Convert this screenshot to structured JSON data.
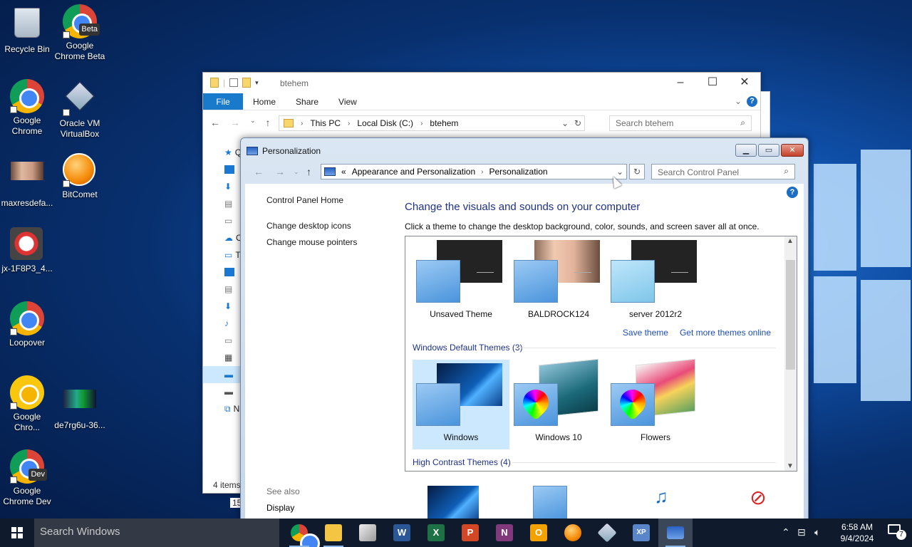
{
  "desktop": {
    "icons": [
      {
        "label": "Recycle Bin",
        "icon": "recycle-bin-icon"
      },
      {
        "label": "Google Chrome Beta",
        "icon": "chrome-beta-icon",
        "badge": "Beta"
      },
      {
        "label": "Google Chrome",
        "icon": "chrome-icon"
      },
      {
        "label": "Oracle VM VirtualBox",
        "icon": "virtualbox-icon"
      },
      {
        "label": "maxresdefa...",
        "icon": "image-file-icon"
      },
      {
        "label": "BitComet",
        "icon": "bitcomet-icon"
      },
      {
        "label": "jx-1F8P3_4...",
        "icon": "app-icon"
      },
      {
        "label": "Loopover",
        "icon": "chrome-app-icon"
      },
      {
        "label": "Google Chro...",
        "icon": "chrome-canary-icon"
      },
      {
        "label": "de7rg6u-36...",
        "icon": "image-file-icon"
      },
      {
        "label": "Google Chrome Dev",
        "icon": "chrome-dev-icon",
        "badge": "Dev"
      }
    ]
  },
  "explorer": {
    "title": "btehem",
    "ribbon_tabs": [
      "File",
      "Home",
      "Share",
      "View"
    ],
    "address": [
      "This PC",
      "Local Disk (C:)",
      "btehem"
    ],
    "search_placeholder": "Search btehem",
    "status": "4 items",
    "status2": "15",
    "nav_cut_letters": [
      "Q",
      "O",
      "T",
      "N"
    ]
  },
  "personalization": {
    "title": "Personalization",
    "breadcrumb_prefix": "«",
    "address": [
      "Appearance and Personalization",
      "Personalization"
    ],
    "search_placeholder": "Search Control Panel",
    "left_links": {
      "home": "Control Panel Home",
      "items": [
        "Change desktop icons",
        "Change mouse pointers"
      ]
    },
    "see_also": {
      "heading": "See also",
      "items": [
        "Display"
      ]
    },
    "heading": "Change the visuals and sounds on your computer",
    "subheading": "Click a theme to change the desktop background, color, sounds, and screen saver all at once.",
    "my_themes": [
      "Unsaved Theme",
      "BALDROCK124",
      "server 2012r2"
    ],
    "actions": {
      "save": "Save theme",
      "more": "Get more themes online"
    },
    "default_group": "Windows Default Themes (3)",
    "default_themes": [
      "Windows",
      "Windows 10",
      "Flowers"
    ],
    "selected_theme": "Windows",
    "high_contrast_group": "High Contrast Themes (4)"
  },
  "taskbar": {
    "search_placeholder": "Search Windows",
    "apps": [
      {
        "icon": "chrome-icon",
        "running": true
      },
      {
        "icon": "file-explorer-icon",
        "running": true
      },
      {
        "icon": "paint-icon",
        "running": false
      },
      {
        "icon": "word-icon",
        "glyph": "W",
        "color": "#2b5797"
      },
      {
        "icon": "excel-icon",
        "glyph": "X",
        "color": "#1e7145"
      },
      {
        "icon": "powerpoint-icon",
        "glyph": "P",
        "color": "#d24726"
      },
      {
        "icon": "onenote-icon",
        "glyph": "N",
        "color": "#80397b"
      },
      {
        "icon": "outlook-icon",
        "glyph": "O",
        "color": "#f2a100"
      },
      {
        "icon": "bitcomet-icon"
      },
      {
        "icon": "virtualbox-icon"
      },
      {
        "icon": "xp-mode-icon",
        "glyph": "XP"
      },
      {
        "icon": "control-panel-icon",
        "active": true
      }
    ],
    "clock_time": "6:58 AM",
    "clock_date": "9/4/2024",
    "notifications": "7"
  },
  "colors": {
    "accent": "#1979ca",
    "link": "#1e4fb5",
    "heading": "#1e3287",
    "selection": "#cce8ff",
    "taskbar": "#0f1b2c"
  }
}
